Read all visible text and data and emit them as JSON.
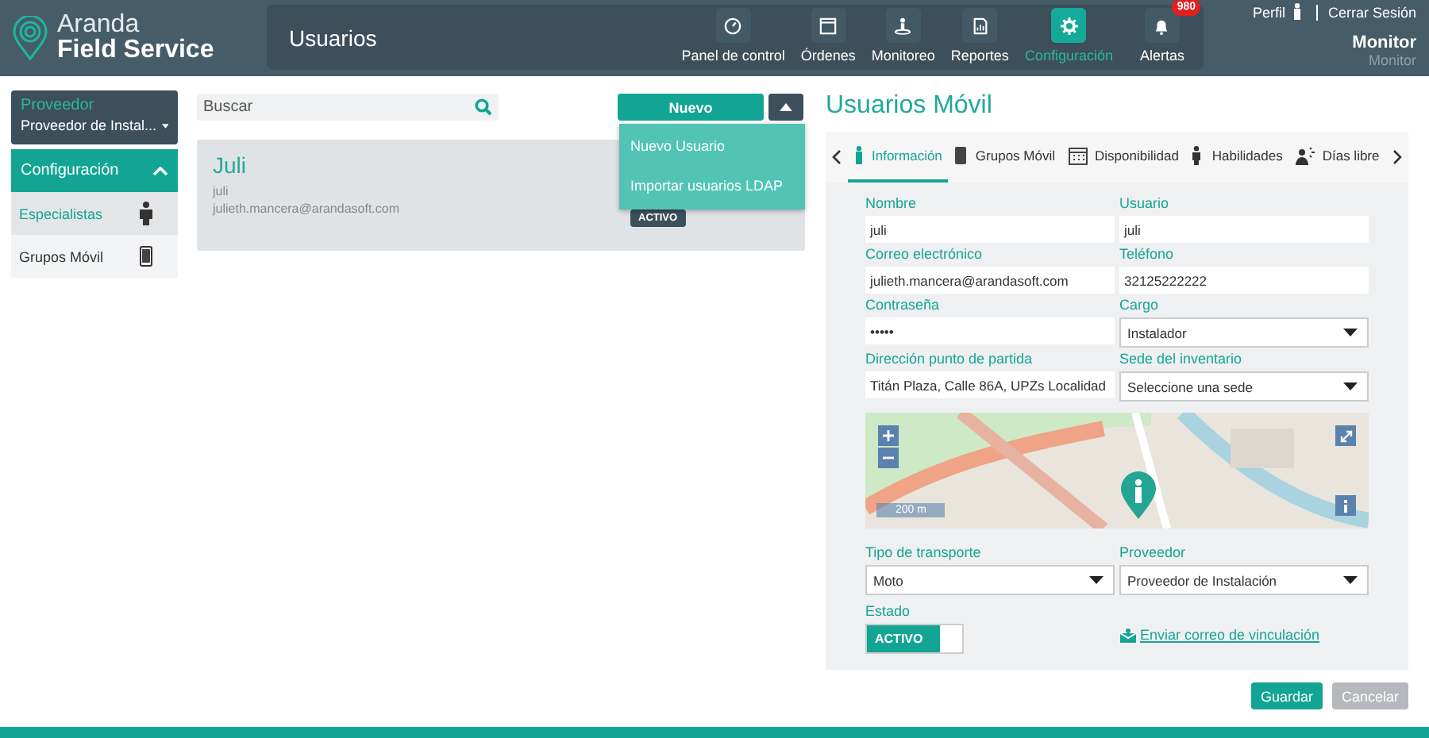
{
  "header": {
    "logo_top": "Aranda",
    "logo_bottom": "Field Service",
    "page_title": "Usuarios",
    "nav": [
      {
        "label": "Panel de control",
        "selected": false
      },
      {
        "label": "Órdenes",
        "selected": false
      },
      {
        "label": "Monitoreo",
        "selected": false
      },
      {
        "label": "Reportes",
        "selected": false
      },
      {
        "label": "Configuración",
        "selected": true
      },
      {
        "label": "Alertas",
        "selected": false,
        "badge": "980"
      }
    ],
    "profile_link": "Perfil",
    "logout_link": "Cerrar Sesión",
    "user_name": "Monitor",
    "user_role": "Monitor"
  },
  "sidebar": {
    "provider_label": "Proveedor",
    "provider_value": "Proveedor de Instal...",
    "section": "Configuración",
    "expanded": true,
    "items": [
      {
        "label": "Especialistas",
        "selected": true
      },
      {
        "label": "Grupos Móvil",
        "selected": false
      }
    ]
  },
  "list": {
    "search": {
      "placeholder": "Buscar"
    },
    "new_button": "Nuevo",
    "menu_open": true,
    "menu": [
      "Nuevo Usuario",
      "Importar usuarios LDAP"
    ],
    "cards": [
      {
        "name": "Juli",
        "user": "juli",
        "email": "julieth.mancera@arandasoft.com",
        "status": "ACTIVO"
      }
    ]
  },
  "form": {
    "title": "Usuarios Móvil",
    "tabs": [
      {
        "label": "Información",
        "selected": true
      },
      {
        "label": "Grupos Móvil",
        "selected": false
      },
      {
        "label": "Disponibilidad",
        "selected": false
      },
      {
        "label": "Habilidades",
        "selected": false
      },
      {
        "label": "Días libre",
        "selected": false
      }
    ],
    "fields": [
      {
        "label": "Nombre",
        "value": "juli",
        "kind": "text"
      },
      {
        "label": "Usuario",
        "value": "juli",
        "kind": "text"
      },
      {
        "label": "Correo electrónico",
        "value": "julieth.mancera@arandasoft.com",
        "kind": "text"
      },
      {
        "label": "Teléfono",
        "value": "32125222222",
        "kind": "text"
      },
      {
        "label": "Contraseña",
        "value": "•••••",
        "kind": "text"
      },
      {
        "label": "Cargo",
        "value": "Instalador",
        "kind": "select"
      },
      {
        "label": "Dirección punto de partida",
        "value": "Titán Plaza, Calle 86A, UPZs Localidad",
        "kind": "address"
      },
      {
        "label": "Sede del inventario",
        "value": "Seleccione una sede",
        "kind": "select"
      }
    ],
    "map": {
      "scale": "200 m"
    },
    "fields_bottom": [
      {
        "label": "Tipo de transporte",
        "value": "Moto",
        "kind": "select"
      },
      {
        "label": "Proveedor",
        "value": "Proveedor de Instalación",
        "kind": "select"
      }
    ],
    "status": {
      "label": "Estado",
      "value": "ACTIVO",
      "on": true
    },
    "email_link": "Enviar correo de vinculación",
    "buttons": [
      {
        "label": "Guardar",
        "kind": "primary"
      },
      {
        "label": "Cancelar",
        "kind": "secondary"
      }
    ]
  }
}
